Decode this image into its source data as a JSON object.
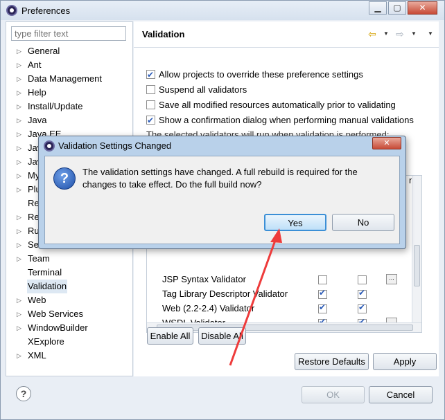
{
  "window": {
    "title": "Preferences"
  },
  "left": {
    "filter_placeholder": "type filter text",
    "tree": [
      {
        "label": "General",
        "expandable": true
      },
      {
        "label": "Ant",
        "expandable": true
      },
      {
        "label": "Data Management",
        "expandable": true
      },
      {
        "label": "Help",
        "expandable": true
      },
      {
        "label": "Install/Update",
        "expandable": true
      },
      {
        "label": "Java",
        "expandable": true
      },
      {
        "label": "Java EE",
        "expandable": true
      },
      {
        "label": "Java",
        "expandable": true
      },
      {
        "label": "Java",
        "expandable": true
      },
      {
        "label": "My",
        "expandable": true
      },
      {
        "label": "Plu",
        "expandable": true
      },
      {
        "label": "Re",
        "expandable": false
      },
      {
        "label": "Re",
        "expandable": true
      },
      {
        "label": "Ru",
        "expandable": true
      },
      {
        "label": "Se",
        "expandable": true
      },
      {
        "label": "Team",
        "expandable": true
      },
      {
        "label": "Terminal",
        "expandable": false
      },
      {
        "label": "Validation",
        "expandable": false,
        "selected": true
      },
      {
        "label": "Web",
        "expandable": true
      },
      {
        "label": "Web Services",
        "expandable": true
      },
      {
        "label": "WindowBuilder",
        "expandable": true
      },
      {
        "label": "XExplore",
        "expandable": false
      },
      {
        "label": "XML",
        "expandable": true
      }
    ]
  },
  "right": {
    "title": "Validation",
    "options": [
      {
        "label": "Allow projects to override these preference settings",
        "checked": true
      },
      {
        "label": "Suspend all validators",
        "checked": false
      },
      {
        "label": "Save all modified resources automatically prior to validating",
        "checked": false
      },
      {
        "label": "Show a confirmation dialog when performing manual validations",
        "checked": true
      }
    ],
    "note": "The selected validators will run when validation is performed:",
    "table_col_fragment": "ng",
    "validators": [
      {
        "name": "JSP Syntax Validator",
        "manual": false,
        "build": false,
        "settings": true
      },
      {
        "name": "Tag Library Descriptor Validator",
        "manual": true,
        "build": true,
        "settings": false
      },
      {
        "name": "Web (2.2-2.4) Validator",
        "manual": true,
        "build": true,
        "settings": false
      },
      {
        "name": "WSDL Validator",
        "manual": true,
        "build": true,
        "settings": true
      }
    ],
    "enable_all": "Enable All",
    "disable_all": "Disable All",
    "restore_defaults": "Restore Defaults",
    "apply": "Apply"
  },
  "footer": {
    "ok": "OK",
    "cancel": "Cancel"
  },
  "dialog": {
    "title": "Validation Settings Changed",
    "message": "The validation settings have changed. A full rebuild is required for the changes to take effect. Do the full build now?",
    "yes": "Yes",
    "no": "No"
  },
  "colors": {
    "annotation_arrow": "#ee3b3b",
    "selection": "#dde8f3",
    "dialog_frame": "#b9d1ea"
  }
}
